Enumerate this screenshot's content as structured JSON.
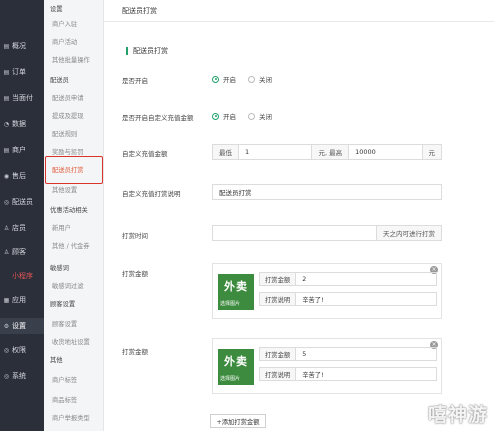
{
  "nav": {
    "items": [
      {
        "icon": "▤",
        "label": "概况"
      },
      {
        "icon": "▤",
        "label": "订单"
      },
      {
        "icon": "▤",
        "label": "当面付"
      },
      {
        "icon": "◔",
        "label": "数据"
      },
      {
        "icon": "▤",
        "label": "商户"
      },
      {
        "icon": "◉",
        "label": "售后"
      },
      {
        "icon": "◎",
        "label": "配送员"
      },
      {
        "icon": "♙",
        "label": "店员"
      },
      {
        "icon": "♙",
        "label": "顾客"
      },
      {
        "icon": "",
        "label": "小程序"
      },
      {
        "icon": "▦",
        "label": "应用"
      },
      {
        "icon": "⚙",
        "label": "设置"
      },
      {
        "icon": "◎",
        "label": "权限"
      },
      {
        "icon": "◎",
        "label": "系统"
      }
    ]
  },
  "submenu": {
    "items": [
      {
        "label": "设置",
        "type": "group"
      },
      {
        "label": "商户入驻",
        "type": "item"
      },
      {
        "label": "商户活动",
        "type": "item"
      },
      {
        "label": "其他批量操作",
        "type": "item"
      },
      {
        "label": "配送员",
        "type": "group"
      },
      {
        "label": "配送员申请",
        "type": "item"
      },
      {
        "label": "提成及提现",
        "type": "item"
      },
      {
        "label": "配送规则",
        "type": "item"
      },
      {
        "label": "奖励与惩罚",
        "type": "item"
      },
      {
        "label": "配送员打赏",
        "type": "sel"
      },
      {
        "label": "其他设置",
        "type": "item"
      },
      {
        "label": "优惠活动相关",
        "type": "group"
      },
      {
        "label": "新用户",
        "type": "item"
      },
      {
        "label": "其他 / 代金券",
        "type": "item"
      },
      {
        "label": "敏感词",
        "type": "group"
      },
      {
        "label": "敏感词过滤",
        "type": "item"
      },
      {
        "label": "顾客设置",
        "type": "group"
      },
      {
        "label": "顾客设置",
        "type": "item"
      },
      {
        "label": "收货地址设置",
        "type": "item"
      },
      {
        "label": "其他",
        "type": "group"
      },
      {
        "label": "商户标签",
        "type": "item"
      },
      {
        "label": "商品标签",
        "type": "item"
      },
      {
        "label": "商户举报类型",
        "type": "item"
      }
    ]
  },
  "header": {
    "title": "配送员打赏"
  },
  "section": {
    "title": "配送员打赏"
  },
  "form": {
    "enabled": {
      "label": "是否开启",
      "on": "开启",
      "off": "关闭"
    },
    "custom_amount": {
      "label": "是否开启自定义充值金额",
      "on": "开启",
      "off": "关闭"
    },
    "range": {
      "label": "自定义充值金额",
      "min_prefix": "最低",
      "min_value": "1",
      "mid_addon": "元, 最高",
      "max_value": "10000",
      "suffix": "元"
    },
    "desc": {
      "label": "自定义充值打赏说明",
      "value": "配送员打赏"
    },
    "time": {
      "label": "打赏时间",
      "suffix": "天之内可进行打赏"
    },
    "rewards": [
      {
        "label": "打赏金额",
        "amount_label": "打赏金额",
        "amount": "2",
        "desc_label": "打赏说明",
        "desc": "辛苦了!",
        "thumb_big": "外卖",
        "thumb_small": "选择图片"
      },
      {
        "label": "打赏金额",
        "amount_label": "打赏金额",
        "amount": "5",
        "desc_label": "打赏说明",
        "desc": "辛苦了!",
        "thumb_big": "外卖",
        "thumb_small": "选择图片"
      }
    ],
    "add_label": "+添加打赏金额"
  },
  "watermark": "嘻神游"
}
